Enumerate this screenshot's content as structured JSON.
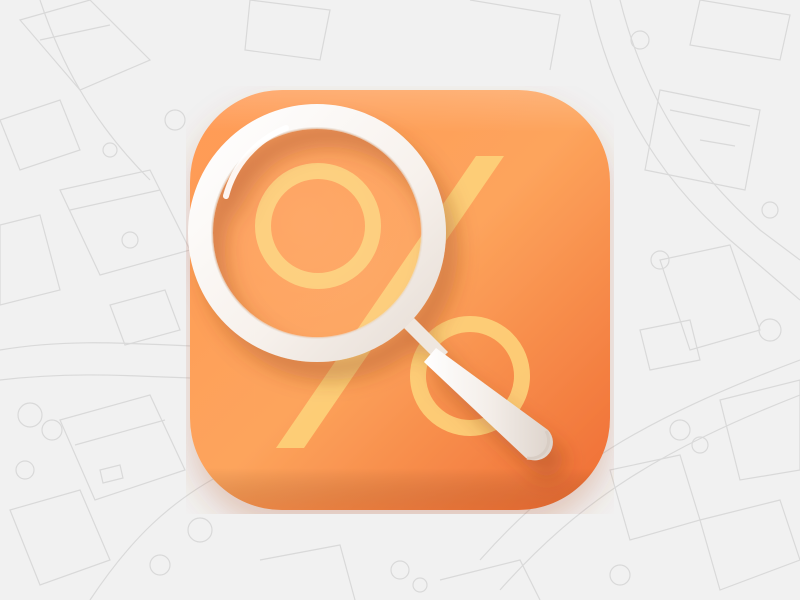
{
  "scene": {
    "title": "",
    "background_color": "#f1f1f1",
    "line_color": "#d6d6d6"
  },
  "app_icon": {
    "semantic": "discount-search-app-icon",
    "tile_gradient": [
      "#fdaa5e",
      "#f6813f",
      "#ef6d34"
    ],
    "percent_color": "#fdd27a",
    "magnifier_color": "#fbf7f3",
    "handle_color": "#f1ebe5",
    "icons": [
      "percent-icon",
      "magnifying-glass-icon"
    ]
  }
}
